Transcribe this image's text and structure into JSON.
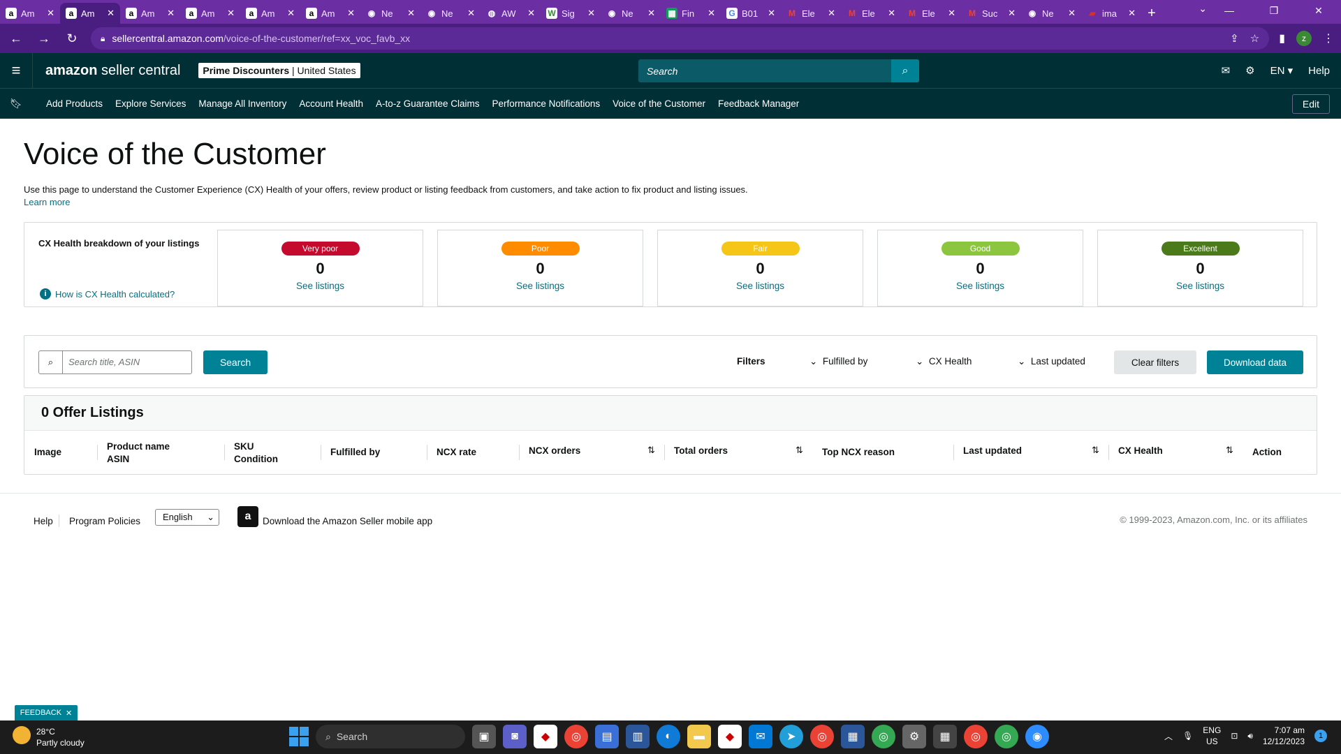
{
  "browser": {
    "tabs": [
      {
        "title": "Am",
        "fav": "a",
        "favbg": "#ffffff",
        "favfg": "#000000"
      },
      {
        "title": "Am",
        "fav": "a",
        "favbg": "#ffffff",
        "favfg": "#000000",
        "active": true
      },
      {
        "title": "Am",
        "fav": "a",
        "favbg": "#ffffff",
        "favfg": "#000000"
      },
      {
        "title": "Am",
        "fav": "a",
        "favbg": "#ffffff",
        "favfg": "#000000"
      },
      {
        "title": "Am",
        "fav": "a",
        "favbg": "#ffffff",
        "favfg": "#000000"
      },
      {
        "title": "Am",
        "fav": "a",
        "favbg": "#ffffff",
        "favfg": "#000000"
      },
      {
        "title": "Ne",
        "fav": "◉",
        "favbg": "#6b2fa3",
        "favfg": "#ffffff"
      },
      {
        "title": "Ne",
        "fav": "◉",
        "favbg": "#6b2fa3",
        "favfg": "#ffffff"
      },
      {
        "title": "AW",
        "fav": "◍",
        "favbg": "#6b2fa3",
        "favfg": "#ffffff"
      },
      {
        "title": "Sig",
        "fav": "W",
        "favbg": "#ffffff",
        "favfg": "#3a8a34"
      },
      {
        "title": "Ne",
        "fav": "◉",
        "favbg": "#6b2fa3",
        "favfg": "#ffffff"
      },
      {
        "title": "Fin",
        "fav": "▦",
        "favbg": "#0f9d58",
        "favfg": "#ffffff"
      },
      {
        "title": "B01",
        "fav": "G",
        "favbg": "#ffffff",
        "favfg": "#4285f4"
      },
      {
        "title": "Ele",
        "fav": "M",
        "favbg": "#6b2fa3",
        "favfg": "#ea4335"
      },
      {
        "title": "Ele",
        "fav": "M",
        "favbg": "#6b2fa3",
        "favfg": "#ea4335"
      },
      {
        "title": "Ele",
        "fav": "M",
        "favbg": "#6b2fa3",
        "favfg": "#ea4335"
      },
      {
        "title": "Suc",
        "fav": "M",
        "favbg": "#6b2fa3",
        "favfg": "#ea4335"
      },
      {
        "title": "Ne",
        "fav": "◉",
        "favbg": "#6b2fa3",
        "favfg": "#ffffff"
      },
      {
        "title": "ima",
        "fav": "▰",
        "favbg": "#6b2fa3",
        "favfg": "#d93025"
      }
    ],
    "url_host": "sellercentral.amazon.com",
    "url_path": "/voice-of-the-customer/ref=xx_voc_favb_xx",
    "profile_initial": "z"
  },
  "header": {
    "logo_bold": "amazon",
    "logo_rest": " seller central",
    "account_name": "Prime Discounters",
    "account_region": "United States",
    "search_placeholder": "Search",
    "language": "EN",
    "help": "Help"
  },
  "nav": {
    "links": [
      "Add Products",
      "Explore Services",
      "Manage All Inventory",
      "Account Health",
      "A-to-z Guarantee Claims",
      "Performance Notifications",
      "Voice of the Customer",
      "Feedback Manager"
    ],
    "edit_label": "Edit"
  },
  "page": {
    "title": "Voice of the Customer",
    "intro": "Use this page to understand the Customer Experience (CX) Health of your offers, review product or listing feedback from customers, and take action to fix product and listing issues.",
    "learn_more": "Learn more",
    "cx_label": "CX Health breakdown of your listings",
    "how_calc": "How is CX Health calculated?",
    "cx_cards": [
      {
        "label": "Very poor",
        "count": "0",
        "link": "See listings",
        "color": "#c40b2e"
      },
      {
        "label": "Poor",
        "count": "0",
        "link": "See listings",
        "color": "#ff8c00"
      },
      {
        "label": "Fair",
        "count": "0",
        "link": "See listings",
        "color": "#f5c518"
      },
      {
        "label": "Good",
        "count": "0",
        "link": "See listings",
        "color": "#8cc63f"
      },
      {
        "label": "Excellent",
        "count": "0",
        "link": "See listings",
        "color": "#4b7a1b"
      }
    ]
  },
  "filters": {
    "search_placeholder": "Search title, ASIN",
    "search_button": "Search",
    "filters_label": "Filters",
    "fulfilled_by": "Fulfilled by",
    "cx_health": "CX Health",
    "last_updated": "Last updated",
    "clear": "Clear filters",
    "download": "Download data"
  },
  "listings": {
    "title": "0 Offer Listings",
    "columns": {
      "image": "Image",
      "product_name": "Product name",
      "asin": "ASIN",
      "sku": "SKU",
      "condition": "Condition",
      "fulfilled_by": "Fulfilled by",
      "ncx_rate": "NCX rate",
      "ncx_orders": "NCX orders",
      "total_orders": "Total orders",
      "top_ncx_reason": "Top NCX reason",
      "last_updated": "Last updated",
      "cx_health": "CX Health",
      "action": "Action"
    }
  },
  "footer": {
    "help": "Help",
    "program_policies": "Program Policies",
    "language": "English",
    "app_text": "Download the Amazon Seller mobile app",
    "copyright": "© 1999-2023, Amazon.com, Inc. or its affiliates",
    "feedback": "FEEDBACK"
  },
  "taskbar": {
    "temp": "28°C",
    "weather": "Partly cloudy",
    "search": "Search",
    "lang_top": "ENG",
    "lang_bottom": "US",
    "time": "7:07 am",
    "date": "12/12/2023",
    "notif_count": "1"
  }
}
